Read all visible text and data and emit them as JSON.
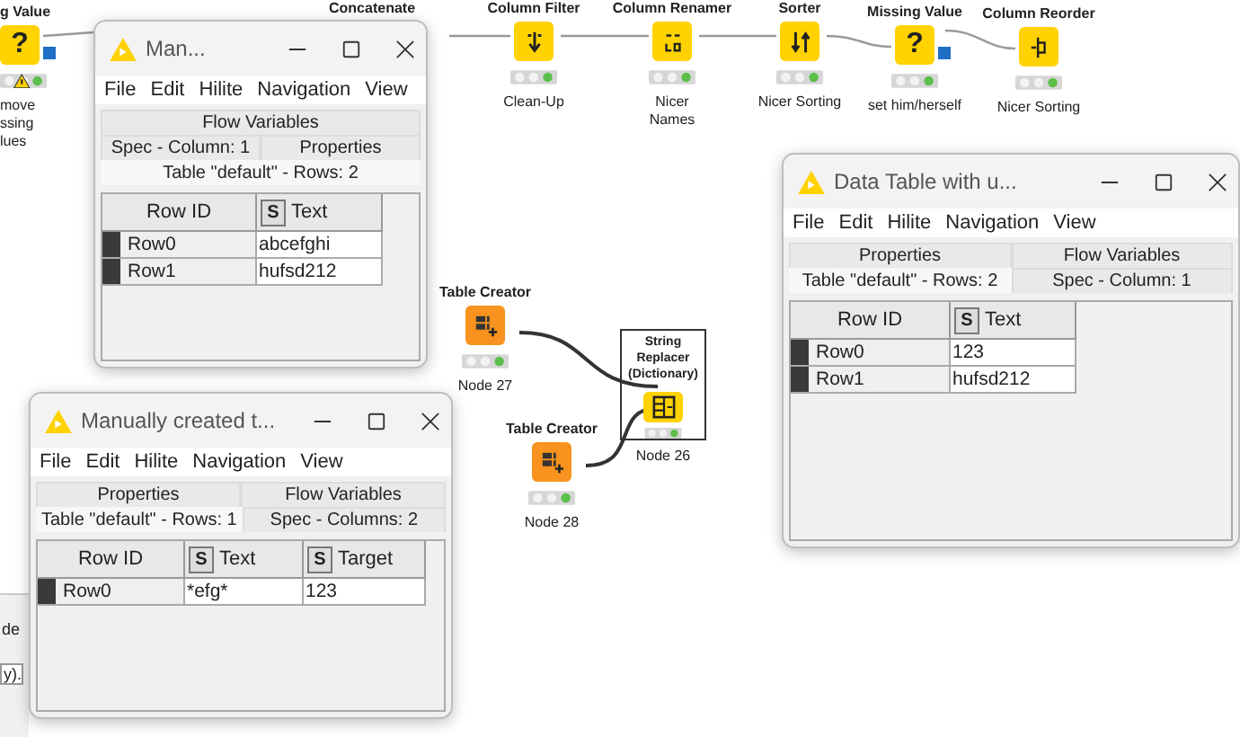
{
  "canvas": {
    "extra_titles": [
      "Concatenate"
    ],
    "nodes": [
      {
        "kind": "missing",
        "glyph": "?",
        "title": "g Value",
        "label_lines": [
          "move",
          "ssing",
          "lues"
        ],
        "warning": true
      },
      {
        "kind": "filter",
        "title": "Column Filter",
        "label_lines": [
          "Clean-Up"
        ],
        "warning": false
      },
      {
        "kind": "renamer",
        "title": "Column Renamer",
        "label_lines": [
          "Nicer",
          "Names"
        ],
        "warning": false
      },
      {
        "kind": "sorter",
        "title": "Sorter",
        "label_lines": [
          "Nicer Sorting"
        ],
        "warning": false
      },
      {
        "kind": "missing",
        "glyph": "?",
        "title": "Missing Value",
        "label_lines": [
          "set him/herself"
        ],
        "warning": false
      },
      {
        "kind": "reorder",
        "title": "Column Reorder",
        "label_lines": [
          "Nicer Sorting"
        ],
        "warning": false
      },
      {
        "kind": "creator",
        "title": "Table Creator",
        "label_lines": [
          "Node 27"
        ],
        "warning": false
      },
      {
        "kind": "creator",
        "title": "Table Creator",
        "label_lines": [
          "Node 28"
        ],
        "warning": false
      },
      {
        "kind": "replacer",
        "title": "String Replacer (Dictionary)",
        "label_lines": [
          "Node 26"
        ],
        "warning": false
      }
    ],
    "console_texts": [
      "de",
      "y)."
    ]
  },
  "windows": [
    {
      "title": "Man...",
      "menu": [
        "File",
        "Edit",
        "Hilite",
        "Navigation",
        "View"
      ],
      "tab_rows": [
        [
          {
            "label": "Flow Variables",
            "selected": false
          }
        ],
        [
          {
            "label": "Spec - Column: 1",
            "selected": false
          },
          {
            "label": "Properties",
            "selected": false
          }
        ],
        [
          {
            "label": "Table \"default\" - Rows: 2",
            "selected": true
          }
        ]
      ],
      "columns": [
        {
          "label": "Row ID"
        },
        {
          "label": "Text",
          "type": "S"
        }
      ],
      "rows": [
        [
          "Row0",
          "abcefghi"
        ],
        [
          "Row1",
          "hufsd212"
        ]
      ]
    },
    {
      "title": "Manually created t...",
      "menu": [
        "File",
        "Edit",
        "Hilite",
        "Navigation",
        "View"
      ],
      "tab_rows": [
        [
          {
            "label": "Properties",
            "selected": false
          },
          {
            "label": "Flow Variables",
            "selected": false
          }
        ],
        [
          {
            "label": "Table \"default\" - Rows: 1",
            "selected": true
          },
          {
            "label": "Spec - Columns: 2",
            "selected": false
          }
        ]
      ],
      "columns": [
        {
          "label": "Row ID"
        },
        {
          "label": "Text",
          "type": "S"
        },
        {
          "label": "Target",
          "type": "S"
        }
      ],
      "rows": [
        [
          "Row0",
          "*efg*",
          "123"
        ]
      ]
    },
    {
      "title": "Data Table with u...",
      "menu": [
        "File",
        "Edit",
        "Hilite",
        "Navigation",
        "View"
      ],
      "tab_rows": [
        [
          {
            "label": "Properties",
            "selected": false
          },
          {
            "label": "Flow Variables",
            "selected": false
          }
        ],
        [
          {
            "label": "Table \"default\" - Rows: 2",
            "selected": true
          },
          {
            "label": "Spec - Column: 1",
            "selected": false
          }
        ]
      ],
      "columns": [
        {
          "label": "Row ID"
        },
        {
          "label": "Text",
          "type": "S"
        }
      ],
      "rows": [
        [
          "Row0",
          "123"
        ],
        [
          "Row1",
          "hufsd212"
        ]
      ]
    }
  ]
}
